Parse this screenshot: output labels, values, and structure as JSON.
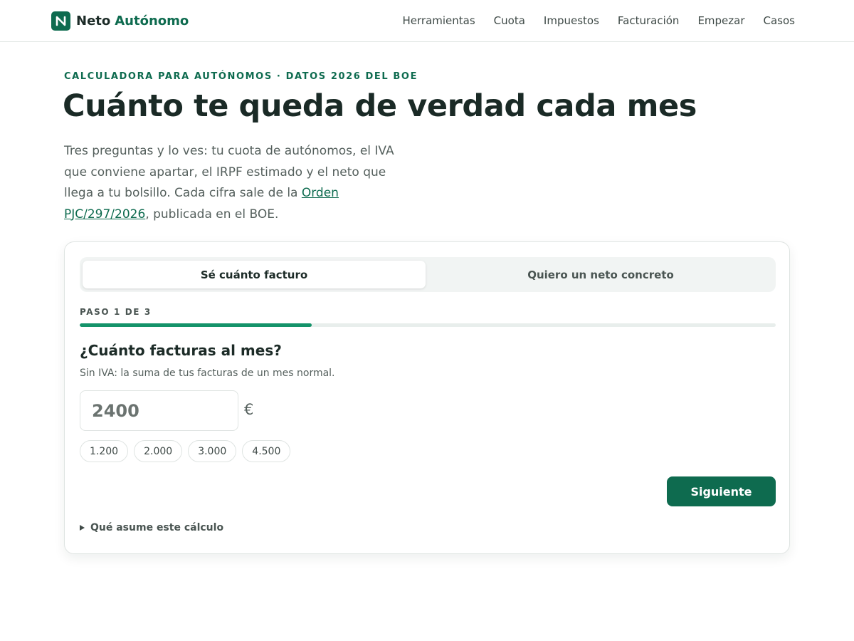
{
  "brand": {
    "name": "Neto",
    "accent": "Autónomo",
    "logo_letter": "N",
    "color": "#0e6b4f"
  },
  "nav": {
    "items": [
      {
        "label": "Herramientas"
      },
      {
        "label": "Cuota"
      },
      {
        "label": "Impuestos"
      },
      {
        "label": "Facturación"
      },
      {
        "label": "Empezar"
      },
      {
        "label": "Casos"
      }
    ]
  },
  "hero": {
    "eyebrow": "CALCULADORA PARA AUTÓNOMOS · DATOS 2026 DEL BOE",
    "title": "Cuánto te queda de verdad cada mes",
    "intro_text": "Tres preguntas y lo ves: tu cuota de autónomos, el IVA que conviene apartar, el IRPF estimado y el neto que llega a tu bolsillo. Cada cifra sale de la ",
    "intro_link": "Orden PJC/297/2026",
    "intro_after": ", publicada en el BOE."
  },
  "calculator": {
    "tabs": [
      {
        "label": "Sé cuánto facturo",
        "active": true
      },
      {
        "label": "Quiero un neto concreto",
        "active": false
      }
    ],
    "step_label": "PASO 1 DE 3",
    "progress_fraction": 0.333,
    "question": "¿Cuánto facturas al mes?",
    "helper": "Sin IVA: la suma de tus facturas de un mes normal.",
    "amount_placeholder": "2400",
    "currency": "€",
    "presets": [
      {
        "label": "1.200"
      },
      {
        "label": "2.000"
      },
      {
        "label": "3.000"
      },
      {
        "label": "4.500"
      }
    ],
    "next_label": "Siguiente",
    "assumptions_label": "Qué asume este cálculo"
  },
  "colors": {
    "accent": "#0e6b4f",
    "progress": "#14936a"
  }
}
